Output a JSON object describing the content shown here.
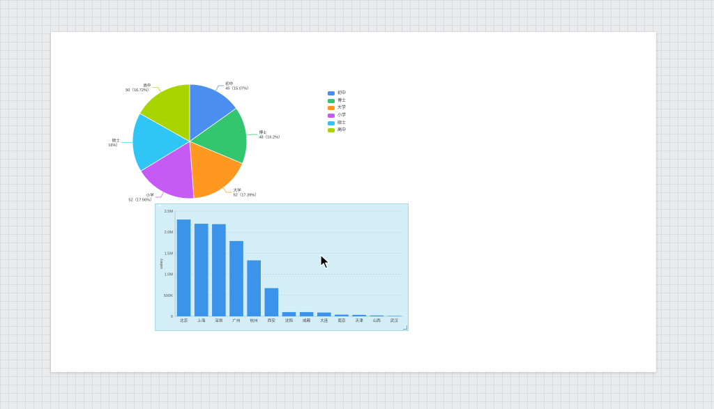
{
  "pie": {
    "chart_data": {
      "type": "pie",
      "slices": [
        {
          "name": "初中",
          "value": 45,
          "percent": "15.07%",
          "color": "#4a8fef"
        },
        {
          "name": "博士",
          "value": 48,
          "percent": "16.2%",
          "color": "#34c66f"
        },
        {
          "name": "大学",
          "value": 52,
          "percent": "17.39%",
          "color": "#ff9820"
        },
        {
          "name": "小学",
          "value": 52,
          "percent": "17.56%",
          "color": "#c65af4"
        },
        {
          "name": "硕士",
          "value": 50,
          "percent": "16%",
          "color": "#2fc5f5"
        },
        {
          "name": "高中",
          "value": 50,
          "percent": "16.72%",
          "color": "#a9d400"
        }
      ],
      "legend": "right"
    },
    "labels": [
      {
        "name": "初中",
        "detail": "45（15.07%）"
      },
      {
        "name": "博士",
        "detail": "48（16.2%）"
      },
      {
        "name": "大学",
        "detail": "52（17.39%）"
      },
      {
        "name": "小学",
        "detail": "52（17.56%）"
      },
      {
        "name": "硕士",
        "detail": "16%）"
      },
      {
        "name": "高中",
        "detail": "50（16.72%）"
      }
    ]
  },
  "bar": {
    "chart_data": {
      "type": "bar",
      "categories": [
        "北京",
        "上海",
        "深圳",
        "广州",
        "杭州",
        "西安",
        "沈阳",
        "成都",
        "大连",
        "南京",
        "天津",
        "山西",
        "武汉"
      ],
      "values": [
        2300000,
        2200000,
        2190000,
        1790000,
        1330000,
        670000,
        100000,
        100000,
        90000,
        40000,
        35000,
        20000,
        10000
      ],
      "ylabel": "salary",
      "yticks": [
        "0",
        "500K",
        "1.0M",
        "1.5M",
        "2.0M",
        "2.5M"
      ],
      "ylim": [
        0,
        2500000
      ],
      "grid": true,
      "bar_color": "#3b93ea",
      "background": "#d3eef6"
    }
  },
  "icons": {
    "expand": "expand-icon",
    "resize": "resize-handle-icon",
    "cursor": "mouse-pointer-icon"
  }
}
